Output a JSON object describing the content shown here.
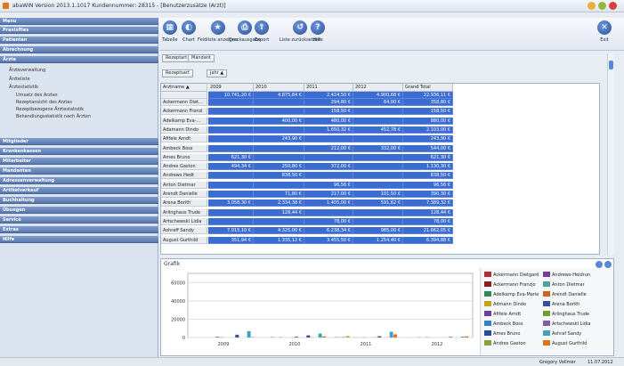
{
  "window": {
    "title": "abaWIN Version 2013.1.1017 Kundennummer: 28315 - [Benutzerzusätze (Arzt)]"
  },
  "sidebar": {
    "sections": [
      "Menu",
      "Praxisfiles",
      "Patienten",
      "Abrechnung",
      "Ärzte",
      "Mitglieder",
      "Krankenkassen",
      "Mitarbeiter",
      "Mandanten",
      "Adressenverwaltung",
      "Artikelverkauf",
      "Buchhaltung",
      "Übungen",
      "Service",
      "Extras",
      "Hilfe"
    ],
    "items": [
      "Ärzteverwaltung",
      "Ärzteliste",
      "Ärztestatistik",
      "Umsatz des Arztes",
      "Rezeptansicht des Arztes",
      "Rezeptbezogene Ärztestatistik",
      "Behandlungsstatistik nach Ärzten"
    ]
  },
  "toolbar": {
    "buttons": [
      "Tabelle",
      "Chart",
      "Feldliste anzeigen",
      "Druckausgabe",
      "Export",
      "Liste zurücksetzen",
      "Hilfe",
      "Exit"
    ]
  },
  "filters": {
    "tags": [
      "Rezeptart",
      "Mandant"
    ],
    "secondary": [
      "Rezeptsart",
      "Jahr ▲"
    ]
  },
  "grid": {
    "corner": "Arztname ▲",
    "columns": [
      "2009",
      "2010",
      "2011",
      "2012",
      "Grand Total"
    ],
    "totals": [
      "10.741,20 €",
      "4.875,84 €",
      "2.424,50 €",
      "4.900,68 €",
      "22.936,11 €"
    ],
    "rows": [
      {
        "name": "Ackermann Diet…",
        "v": [
          "",
          "",
          "294,80 €",
          "64,00 €",
          "358,80 €"
        ]
      },
      {
        "name": "Ackermann Franzi",
        "v": [
          "",
          "",
          "158,50 €",
          "",
          "158,50 €"
        ]
      },
      {
        "name": "Adelkamp Eva-…",
        "v": [
          "",
          "400,00 €",
          "480,00 €",
          "",
          "880,00 €"
        ]
      },
      {
        "name": "Adamann Dindo",
        "v": [
          "",
          "",
          "1.650,32 €",
          "452,78 €",
          "2.103,00 €"
        ]
      },
      {
        "name": "Afifele Arndt",
        "v": [
          "",
          "243,90 €",
          "",
          "",
          "243,90 €"
        ]
      },
      {
        "name": "Ambeck Boss",
        "v": [
          "",
          "",
          "212,00 €",
          "332,00 €",
          "544,00 €"
        ]
      },
      {
        "name": "Ames Bruno",
        "v": [
          "621,30 €",
          "",
          "",
          "",
          "621,30 €"
        ]
      },
      {
        "name": "Andres Gaston",
        "v": [
          "494,34 €",
          "250,80 €",
          "372,00 €",
          "",
          "1.130,30 €"
        ]
      },
      {
        "name": "Andrews Hedt",
        "v": [
          "",
          "838,50 €",
          "",
          "",
          "838,50 €"
        ]
      },
      {
        "name": "Anton Dietmar",
        "v": [
          "",
          "",
          "96,56 €",
          "",
          "96,56 €"
        ]
      },
      {
        "name": "Arendt Danielle",
        "v": [
          "",
          "71,80 €",
          "217,00 €",
          "101,50 €",
          "390,30 €"
        ]
      },
      {
        "name": "Arena Borith",
        "v": [
          "3.058,30 €",
          "2.334,38 €",
          "1.405,00 €",
          "591,62 €",
          "7.389,32 €"
        ]
      },
      {
        "name": "Arlinghaus Trude",
        "v": [
          "",
          "128,44 €",
          "",
          "",
          "128,44 €"
        ]
      },
      {
        "name": "Artschewski Lidia",
        "v": [
          "",
          "",
          "78,00 €",
          "",
          "78,00 €"
        ]
      },
      {
        "name": "Ashraff Sandy",
        "v": [
          "7.015,10 €",
          "4.325,00 €",
          "6.238,34 €",
          "985,00 €",
          "21.662,05 €"
        ]
      },
      {
        "name": "August Gurthild",
        "v": [
          "351,94 €",
          "1.335,12 €",
          "3.455,50 €",
          "1.254,40 €",
          "6.394,88 €"
        ]
      }
    ]
  },
  "chart": {
    "title": "Grafik"
  },
  "chart_data": {
    "type": "bar",
    "categories": [
      "2009",
      "2010",
      "2011",
      "2012"
    ],
    "yticks": [
      "0",
      "20000",
      "40000",
      "60000"
    ],
    "ylim": [
      0,
      70000
    ],
    "series": [
      {
        "name": "Ackermann Dietgard",
        "color": "#b03030",
        "values": [
          0,
          0,
          295,
          64
        ]
      },
      {
        "name": "Ackermann Franzjo",
        "color": "#8b1e1e",
        "values": [
          0,
          0,
          159,
          0
        ]
      },
      {
        "name": "Adelkamp Eva-Marie",
        "color": "#2e8b57",
        "values": [
          0,
          400,
          480,
          0
        ]
      },
      {
        "name": "Admann Dindo",
        "color": "#c8a020",
        "values": [
          0,
          0,
          1650,
          453
        ]
      },
      {
        "name": "Afifele Arndt",
        "color": "#6a3fa0",
        "values": [
          0,
          244,
          0,
          0
        ]
      },
      {
        "name": "Ambeck Boss",
        "color": "#3c7fc0",
        "values": [
          0,
          0,
          212,
          332
        ]
      },
      {
        "name": "Ames Bruno",
        "color": "#1f4ea0",
        "values": [
          621,
          0,
          0,
          0
        ]
      },
      {
        "name": "Andres Gaston",
        "color": "#8aa040",
        "values": [
          494,
          251,
          372,
          0
        ]
      },
      {
        "name": "Andrews-Heidrun",
        "color": "#7a3a9a",
        "values": [
          0,
          839,
          0,
          0
        ]
      },
      {
        "name": "Anton Dietmar",
        "color": "#50a0a0",
        "values": [
          0,
          0,
          97,
          0
        ]
      },
      {
        "name": "Arendt Danielle",
        "color": "#d06020",
        "values": [
          0,
          72,
          217,
          102
        ]
      },
      {
        "name": "Arena Borith",
        "color": "#3050a0",
        "values": [
          3058,
          2334,
          1405,
          592
        ]
      },
      {
        "name": "Arlinghaus Trude",
        "color": "#70a030",
        "values": [
          0,
          128,
          0,
          0
        ]
      },
      {
        "name": "Artschewski Lidia",
        "color": "#7c5fa8",
        "values": [
          0,
          0,
          78,
          0
        ]
      },
      {
        "name": "Ashraf Sandy",
        "color": "#40a0c0",
        "values": [
          7015,
          4325,
          6238,
          985
        ]
      },
      {
        "name": "August Gurthild",
        "color": "#e07020",
        "values": [
          352,
          1335,
          3456,
          1254
        ]
      }
    ]
  },
  "status": {
    "user": "Gregory Vollmer",
    "date": "11.07.2012"
  }
}
